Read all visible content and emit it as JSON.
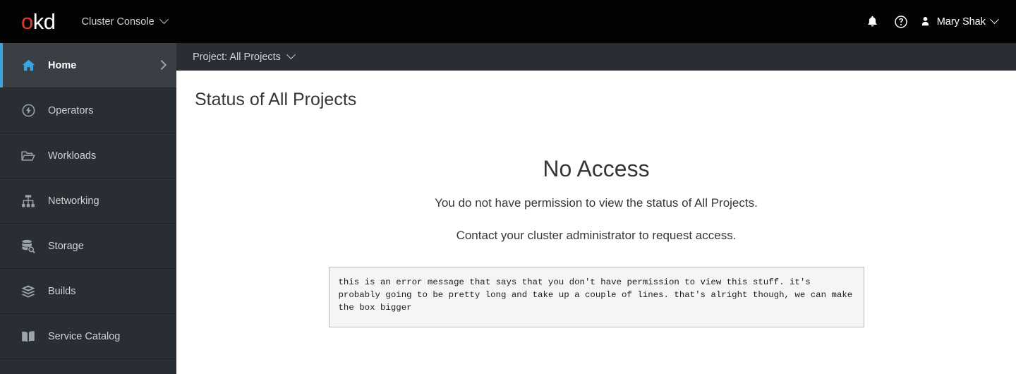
{
  "masthead": {
    "logo": {
      "part_red": "o",
      "part_white": "kd",
      "alt": "okd"
    },
    "console_switcher": {
      "label": "Cluster Console",
      "icon": "chevron-down-icon"
    },
    "notifications": {
      "icon": "bell-icon",
      "label": "Notifications"
    },
    "help": {
      "icon": "help-circle-icon",
      "label": "Help"
    },
    "user": {
      "name": "Mary Shak",
      "avatar_icon": "user-avatar-icon",
      "caret_icon": "chevron-down-icon"
    }
  },
  "sidebar": {
    "items": [
      {
        "label": "Home",
        "icon": "home-icon",
        "active": true,
        "expander": "chevron-right-icon"
      },
      {
        "label": "Operators",
        "icon": "operators-bolt-icon",
        "active": false
      },
      {
        "label": "Workloads",
        "icon": "folder-open-icon",
        "active": false
      },
      {
        "label": "Networking",
        "icon": "sitemap-icon",
        "active": false
      },
      {
        "label": "Storage",
        "icon": "database-search-icon",
        "active": false
      },
      {
        "label": "Builds",
        "icon": "layers-icon",
        "active": false
      },
      {
        "label": "Service Catalog",
        "icon": "open-book-icon",
        "active": false
      }
    ]
  },
  "project_bar": {
    "selector_label": "Project: All Projects",
    "caret_icon": "chevron-down-icon"
  },
  "main": {
    "page_title": "Status of All Projects",
    "no_access": {
      "heading": "No Access",
      "line1": "You do not have permission to view the status of All Projects.",
      "line2": "Contact your cluster administrator to request access."
    },
    "error_box": {
      "message": "this is an error message that says that you don't have permission to view this stuff. it's probably going to be pretty long and take up a couple of lines. that's alright though, we can make the box bigger"
    }
  },
  "colors": {
    "masthead_bg": "#030303",
    "sidebar_bg": "#292e34",
    "sidebar_active_bg": "#393f44",
    "accent_blue": "#39a5dc",
    "logo_red": "#e8372b",
    "content_bg": "#ffffff",
    "error_box_bg": "#f5f5f5",
    "error_box_border": "#bbbbbb",
    "text_dark": "#363636"
  }
}
